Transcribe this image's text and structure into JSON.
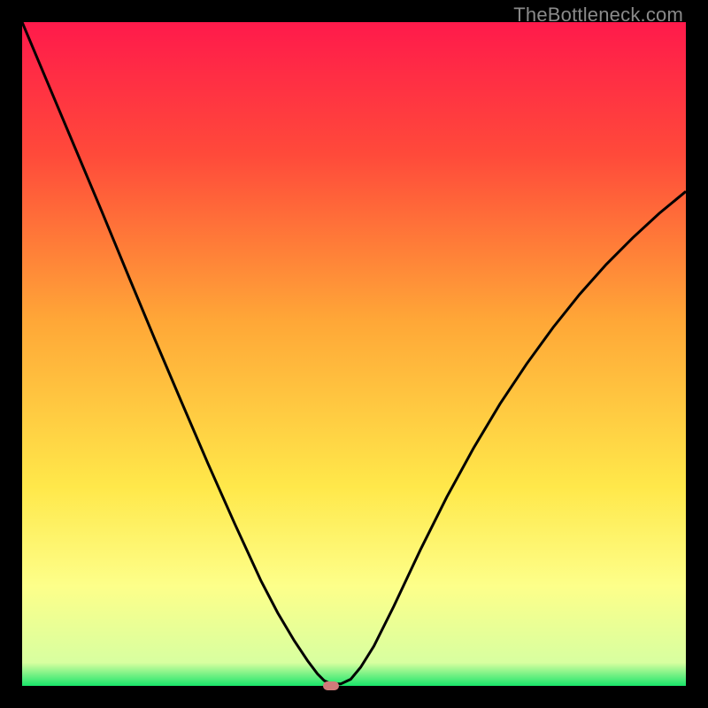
{
  "watermark": "TheBottleneck.com",
  "chart_data": {
    "type": "line",
    "title": "",
    "xlabel": "",
    "ylabel": "",
    "xlim": [
      0,
      1
    ],
    "ylim": [
      0,
      1
    ],
    "gradient_stops": [
      {
        "pos": 0.0,
        "color": "#ff1a4b"
      },
      {
        "pos": 0.2,
        "color": "#ff4a3a"
      },
      {
        "pos": 0.45,
        "color": "#ffa737"
      },
      {
        "pos": 0.7,
        "color": "#ffe84a"
      },
      {
        "pos": 0.85,
        "color": "#fdff8a"
      },
      {
        "pos": 0.965,
        "color": "#d8ffa0"
      },
      {
        "pos": 1.0,
        "color": "#19e56a"
      }
    ],
    "series": [
      {
        "name": "bottleneck-curve",
        "x": [
          0.0,
          0.04,
          0.08,
          0.12,
          0.16,
          0.2,
          0.24,
          0.28,
          0.32,
          0.36,
          0.385,
          0.41,
          0.43,
          0.445,
          0.455,
          0.465,
          0.48,
          0.495,
          0.51,
          0.53,
          0.56,
          0.6,
          0.64,
          0.68,
          0.72,
          0.76,
          0.8,
          0.84,
          0.88,
          0.92,
          0.96,
          1.0
        ],
        "y": [
          1.0,
          0.905,
          0.81,
          0.715,
          0.618,
          0.522,
          0.428,
          0.335,
          0.245,
          0.158,
          0.11,
          0.068,
          0.038,
          0.018,
          0.008,
          0.003,
          0.003,
          0.01,
          0.028,
          0.06,
          0.12,
          0.205,
          0.285,
          0.358,
          0.425,
          0.485,
          0.54,
          0.59,
          0.635,
          0.675,
          0.712,
          0.745
        ]
      }
    ],
    "marker": {
      "x": 0.465,
      "y": 0.0,
      "color": "#cf7a7a"
    }
  }
}
